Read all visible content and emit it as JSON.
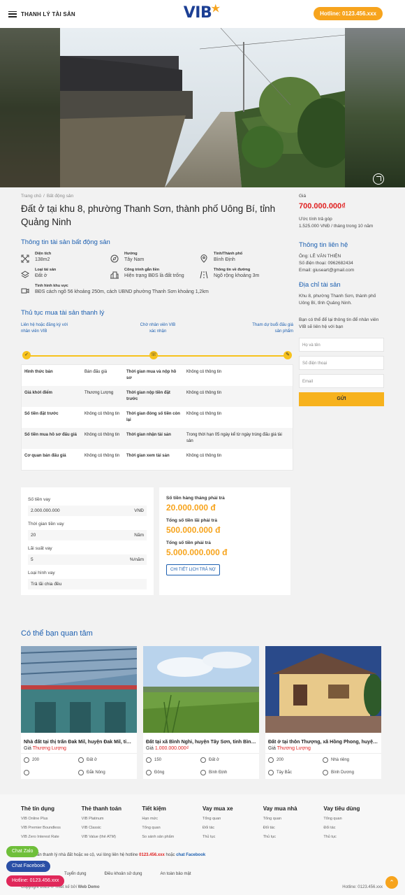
{
  "header": {
    "menu_label": "THANH LÝ TÀI SẢN",
    "logo_text": "VIB",
    "hotline_label": "Hotline: 0123.456.xxx"
  },
  "breadcrumb": {
    "home": "Trang chủ",
    "category": "Bất động sản"
  },
  "title": "Đất ở tại khu 8, phường Thanh Sơn, thành phố Uông Bí, tỉnh Quảng Ninh",
  "property_info": {
    "heading": "Thông tin tài sản bất động sản",
    "specs": [
      {
        "label": "Diện tích",
        "value": "138m2",
        "icon": "area-icon"
      },
      {
        "label": "Hướng",
        "value": "Tây Nam",
        "icon": "compass-icon"
      },
      {
        "label": "Tỉnh/Thành phố",
        "value": "Bình Định",
        "icon": "location-pin-icon"
      },
      {
        "label": "Loại tài sản",
        "value": "Đất ở",
        "icon": "layers-icon"
      },
      {
        "label": "Công trình gắn liền",
        "value": "Hiện trạng BĐS là đất trống",
        "icon": "building-icon"
      },
      {
        "label": "Thông tin về đường",
        "value": "Ngõ rộng khoảng 3m",
        "icon": "road-icon"
      },
      {
        "label": "Tình hình khu vực",
        "value": "BĐS cách ngõ 56 khoảng 250m, cách UBND phường Thanh Sơn khoảng 1,2km",
        "icon": "video-icon"
      }
    ]
  },
  "procedure": {
    "heading": "Thủ tục mua tài sản thanh lý",
    "steps": [
      "Liên hệ hoặc đăng ký với nhân viên VIB",
      "Chờ nhân viên VIB xác nhận",
      "Tham dự buổi đấu giá sản phẩm"
    ]
  },
  "sale_table": [
    [
      "Hình thức bán",
      "Bán đấu giá",
      "Thời gian mua và nộp hồ sơ",
      "Không có thông tin"
    ],
    [
      "Giá khởi điểm",
      "Thương Lượng",
      "Thời gian nộp tiền đặt trước",
      "Không có thông tin"
    ],
    [
      "Số tiền đặt trước",
      "Không có thông tin",
      "Thời gian đóng số tiền còn lại",
      "Không có thông tin"
    ],
    [
      "Số tiền mua hồ sơ đấu giá",
      "Không có thông tin",
      "Thời gian nhận tài sản",
      "Trong thời hạn 05 ngày kể từ ngày trúng đấu giá tài sản"
    ],
    [
      "Cơ quan bán đấu giá",
      "Không có thông tin",
      "Thời gian xem tài sản",
      "Không có thông tin"
    ]
  ],
  "loan_calc": {
    "amount_label": "Số tiền vay",
    "amount_value": "2.000.000.000",
    "amount_unit": "VNĐ",
    "term_label": "Thời gian tiền vay",
    "term_value": "20",
    "term_unit": "Năm",
    "rate_label": "Lãi suất vay",
    "rate_value": "5",
    "rate_unit": "%/năm",
    "type_label": "Loại hình vay",
    "type_value": "Trả lãi chia đều",
    "monthly_label": "Số tiền hàng tháng phải trả",
    "monthly_value": "20.000.000 đ",
    "interest_label": "Tổng số tiền lãi phải trả",
    "interest_value": "500.000.000 đ",
    "total_label": "Tổng số tiền phải trả",
    "total_value": "5.000.000.000 đ",
    "detail_button": "CHI TIẾT LỊCH TRẢ NỢ"
  },
  "sidebar": {
    "price_label": "Giá",
    "price_value": "700.000.000₫",
    "installment_label": "Ước tính trả góp",
    "installment_value": "1.525.000 VNĐ / tháng trong 10 năm",
    "contact_heading": "Thông tin liên hệ",
    "contact_name": "Ông: LÊ VĂN THIỆN",
    "contact_phone": "Số điện thoại: 0962682434",
    "contact_email": "Email: giuseart@gmail.com",
    "address_heading": "Địa chỉ tài sản",
    "address_text": "Khu 8, phường Thanh Sơn, thành phố Uông Bí, tỉnh Quảng Ninh.",
    "form_intro": "Bạn có thể để lại thông tin để nhân viên VIB sẽ liên hệ với bạn",
    "name_placeholder": "Họ và tên",
    "phone_placeholder": "Số điện thoại",
    "email_placeholder": "Email",
    "submit_label": "GỬI"
  },
  "related": {
    "heading": "Có thể bạn quan tâm",
    "cards": [
      {
        "title": "Nhà đất tại thị trấn Đak Mil, huyện Đak Mil, tỉnh Đắk Nông",
        "price_label": "Giá",
        "price": "Thương Lượng",
        "area": "200",
        "type": "Đất ở",
        "region": "",
        "province": "Đắk Nông"
      },
      {
        "title": "Đất tại xã Bình Nghi, huyện Tây Sơn, tỉnh Bình Định",
        "price_label": "Giá",
        "price": "1.000.000.000₫",
        "area": "150",
        "type": "Đất ở",
        "region": "Đông",
        "province": "Bình Định"
      },
      {
        "title": "Đất ở tại thôn Thượng, xã Hồng Phong, huyện Ninh Giang",
        "price_label": "Giá",
        "price": "Thương Lượng",
        "area": "200",
        "type": "Nhà riêng",
        "region": "Tây Bắc",
        "province": "Bình Dương"
      }
    ]
  },
  "footer": {
    "columns": [
      {
        "head": "Thẻ tín dụng",
        "items": [
          "VIB Online Plus",
          "VIB Premier Boundless",
          "VIB Zero Interest Rate"
        ]
      },
      {
        "head": "Thẻ thanh toán",
        "items": [
          "VIB Platinum",
          "VIB Classic",
          "VIB Value (thẻ ATM)"
        ]
      },
      {
        "head": "Tiết kiệm",
        "items": [
          "Hạn mức",
          "Tổng quan",
          "So sánh sản phẩm"
        ]
      },
      {
        "head": "Vay mua xe",
        "items": [
          "Tổng quan",
          "Đối tác",
          "Thủ tục"
        ]
      },
      {
        "head": "Vay mua nhà",
        "items": [
          "Tổng quan",
          "Đối tác",
          "Thủ tục"
        ]
      },
      {
        "head": "Vay tiêu dùng",
        "items": [
          "Tổng quan",
          "Đối tác",
          "Thủ tục"
        ]
      }
    ],
    "contact_text": "Cần tư vấn thanh lý nhà đất hoặc xe cộ, vui lòng liên hệ hotline",
    "contact_hotline": "0123.456.xxx",
    "contact_or": "hoặc",
    "contact_fb": "chat Facebook",
    "links": [
      "Tuyển dụng",
      "Điều khoản sử dụng",
      "An toàn bảo mật"
    ],
    "copyright": "Copyright 2023 © Thiết kế bởi",
    "copyright_brand": "Web Demo",
    "hotline": "Hotline: 0123.456.xxx"
  },
  "float": {
    "zalo": "Chat Zalo",
    "facebook": "Chat Facebook",
    "hotline": "Hotline: 0123.456.xxx"
  },
  "colors": {
    "brand_blue": "#1c5fb0",
    "accent_orange": "#f7a41d",
    "price_red": "#e02020"
  }
}
